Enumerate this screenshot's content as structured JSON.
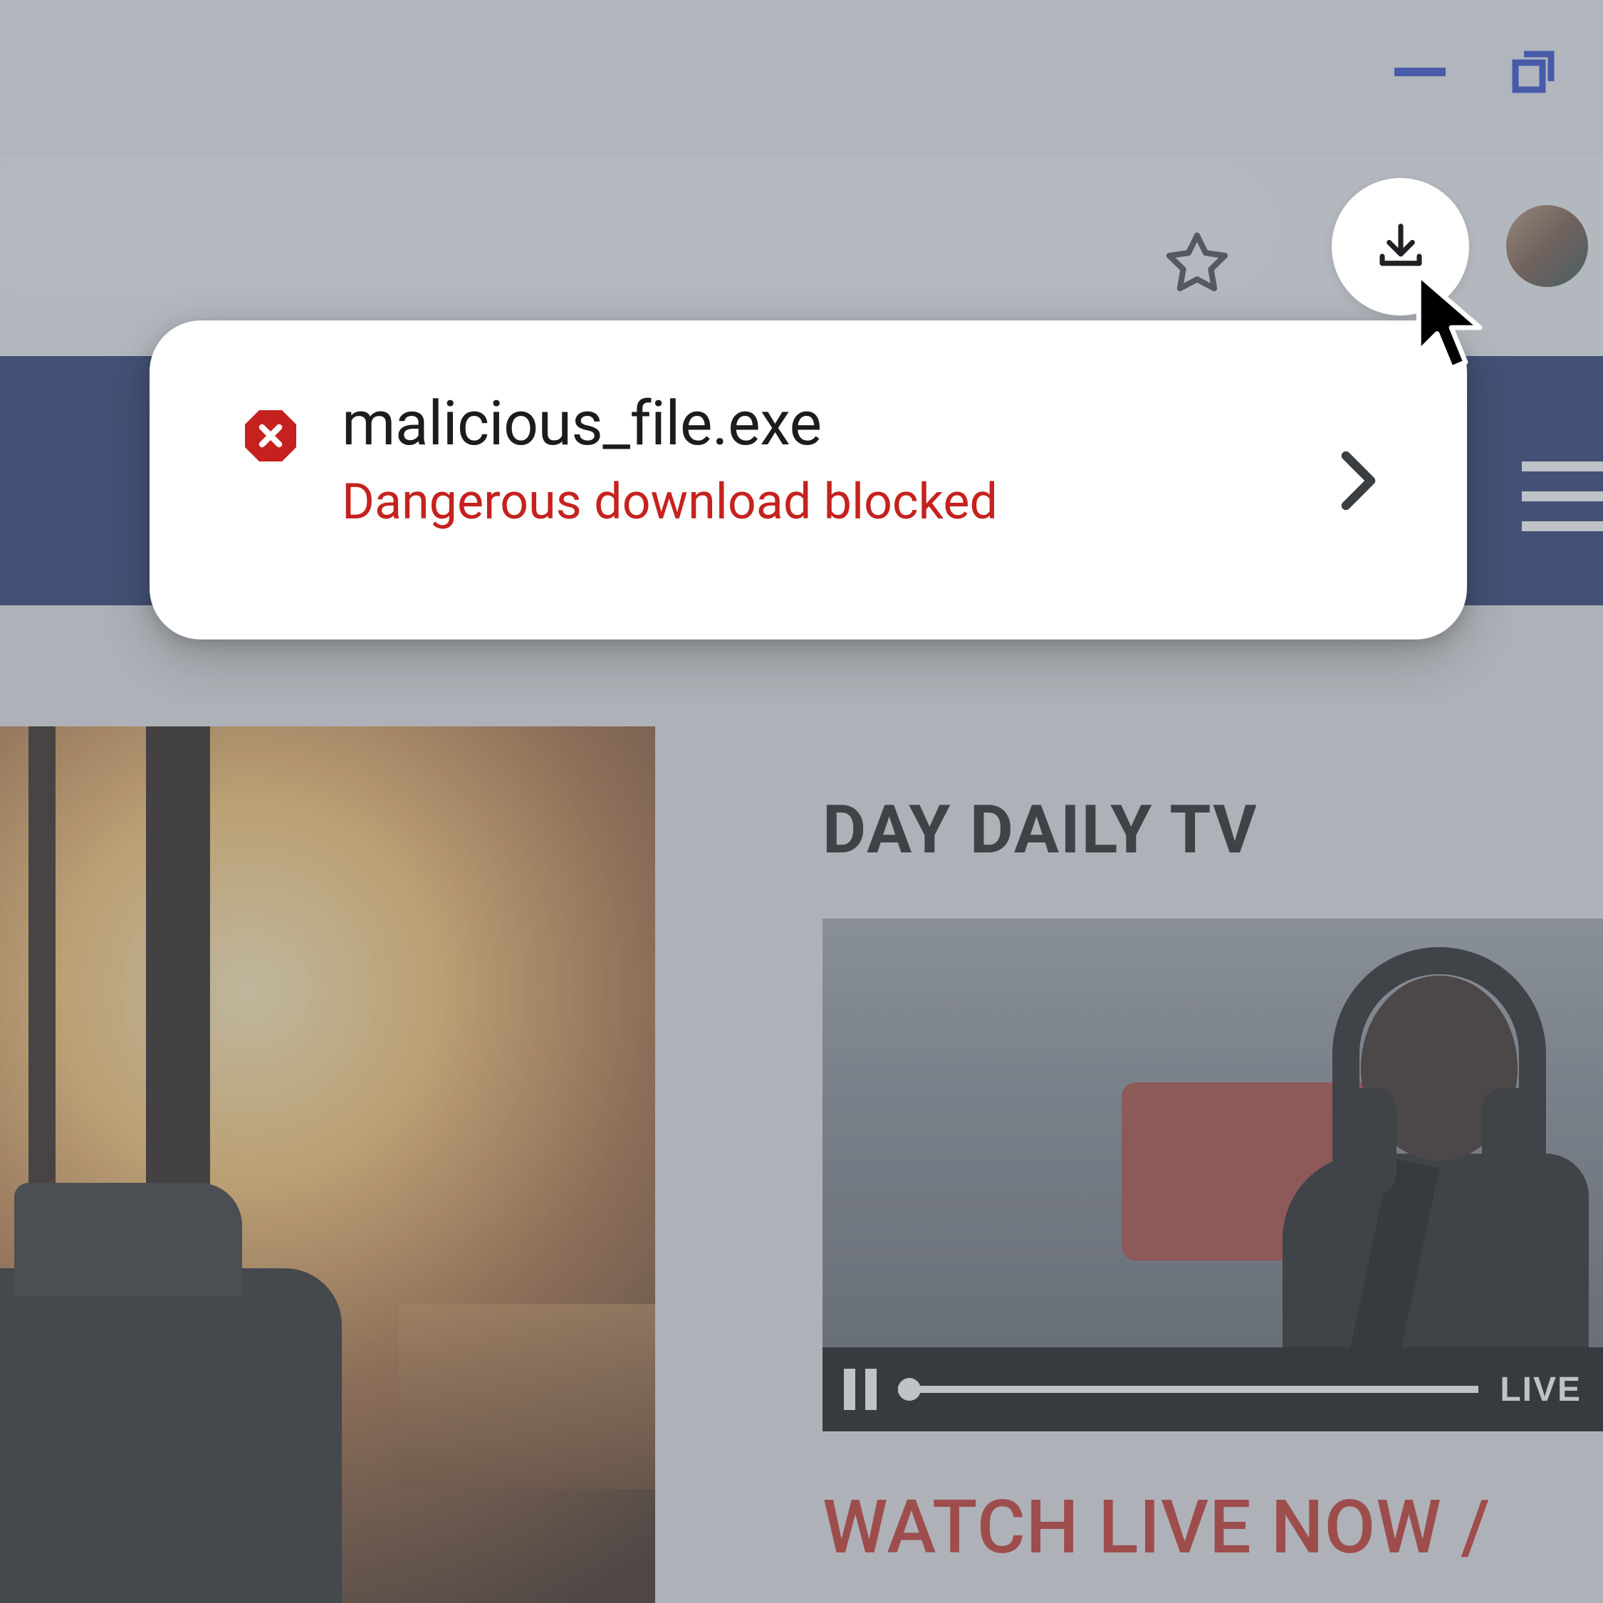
{
  "toolbar": {
    "icons": {
      "star": "star-icon",
      "downloads": "download-tray-icon",
      "minimize": "minimize-icon",
      "maximize": "maximize-icon",
      "avatar": "profile-avatar",
      "menu": "hamburger-icon"
    }
  },
  "download_popup": {
    "filename": "malicious_file.exe",
    "status": "Dangerous download blocked",
    "danger_icon": "stop-octagon-icon",
    "chevron_icon": "chevron-right-icon"
  },
  "page": {
    "section_title": "DAY DAILY TV",
    "video": {
      "live_label": "LIVE",
      "pause_icon": "pause-icon"
    },
    "watch_now": "WATCH LIVE NOW /"
  },
  "colors": {
    "danger": "#c5221f",
    "brand_blue": "#122d6b",
    "accent_blue": "#1a3fd6"
  }
}
